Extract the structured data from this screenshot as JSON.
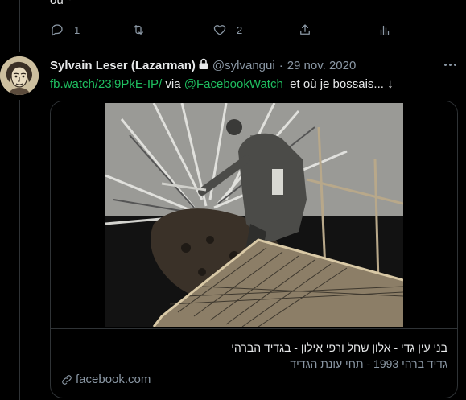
{
  "previous_tweet": {
    "text_fragment": "où *",
    "actions": {
      "reply_count": "1",
      "retweet_count": "",
      "like_count": "2"
    }
  },
  "tweet": {
    "author_name": "Sylvain Leser (Lazarman)",
    "handle": "@sylvangui",
    "separator": "·",
    "date": "29 nov. 2020",
    "link_text": "fb.watch/23i9PkE-IP/",
    "via_text": "via",
    "mention": "@FacebookWatch",
    "tail_text": "et où je bossais... ↓"
  },
  "card": {
    "title": "בני עין גדי - אלון שחל ורפי אילון - בגדיד הברהי",
    "description": "גדיד ברהי 1993 - תחי עונת הגדיד",
    "domain": "facebook.com"
  },
  "colors": {
    "link": "#1d9bf0",
    "mention": "#1fbf60",
    "muted": "#8b98a5",
    "border": "#2f3336"
  },
  "icons": [
    "reply-icon",
    "retweet-icon",
    "like-icon",
    "share-icon",
    "analytics-icon",
    "lock-icon",
    "more-icon",
    "link-icon"
  ]
}
